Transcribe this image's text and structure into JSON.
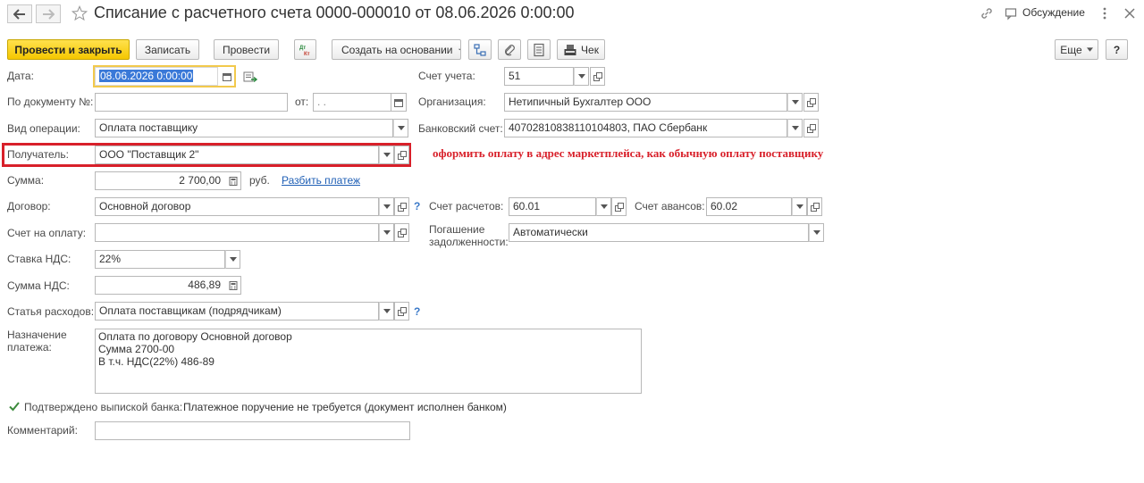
{
  "window": {
    "title": "Списание с расчетного счета 0000-000010 от 08.06.2026 0:00:00",
    "discuss_label": "Обсуждение"
  },
  "toolbar": {
    "post_and_close": "Провести и закрыть",
    "save": "Записать",
    "post": "Провести",
    "dt_kt": "Дт Кт",
    "create_based_on": "Создать на основании",
    "check": "Чек",
    "more": "Еще",
    "help": "?"
  },
  "form": {
    "date": {
      "label": "Дата:",
      "value": "08.06.2026  0:00:00"
    },
    "doc_number": {
      "label": "По документу №:",
      "value": ""
    },
    "doc_from": {
      "label": "от:",
      "value": " .  ."
    },
    "operation_type": {
      "label": "Вид операции:",
      "value": "Оплата поставщику"
    },
    "recipient": {
      "label": "Получатель:",
      "value": "ООО \"Поставщик 2\""
    },
    "amount": {
      "label": "Сумма:",
      "value": "2 700,00",
      "currency": "руб.",
      "split_link": "Разбить платеж"
    },
    "contract": {
      "label": "Договор:",
      "value": "Основной договор"
    },
    "invoice": {
      "label": "Счет на оплату:",
      "value": ""
    },
    "vat_rate": {
      "label": "Ставка НДС:",
      "value": "22%"
    },
    "vat_amount": {
      "label": "Сумма НДС:",
      "value": "486,89"
    },
    "expense_item": {
      "label": "Статья расходов:",
      "value": "Оплата поставщикам (подрядчикам)"
    },
    "purpose": {
      "label_line1": "Назначение",
      "label_line2": "платежа:",
      "value": "Оплата по договору Основной договор\nСумма 2700-00\nВ т.ч. НДС(22%) 486-89"
    },
    "bank_confirmed": {
      "label": "Подтверждено выпиской банка:",
      "checked": true,
      "status_text": "Платежное поручение не требуется (документ исполнен банком)"
    },
    "comment": {
      "label": "Комментарий:",
      "value": ""
    },
    "account": {
      "label": "Счет учета:",
      "value": "51"
    },
    "organization": {
      "label": "Организация:",
      "value": "Нетипичный Бухгалтер ООО"
    },
    "bank_account": {
      "label": "Банковский счет:",
      "value": "40702810838110104803, ПАО Сбербанк"
    },
    "settlement_account": {
      "label": "Счет расчетов:",
      "value": "60.01"
    },
    "advance_account": {
      "label": "Счет авансов:",
      "value": "60.02"
    },
    "debt_repayment": {
      "label_line1": "Погашение",
      "label_line2": "задолженности:",
      "value": "Автоматически"
    }
  },
  "annotation": {
    "text": "оформить оплату в адрес маркетплейса, как обычную оплату поставщику",
    "color": "#d8202a"
  },
  "colors": {
    "primary_button": "#f5c700",
    "link": "#1f5fb5",
    "date_highlight": "#3a79d8"
  }
}
